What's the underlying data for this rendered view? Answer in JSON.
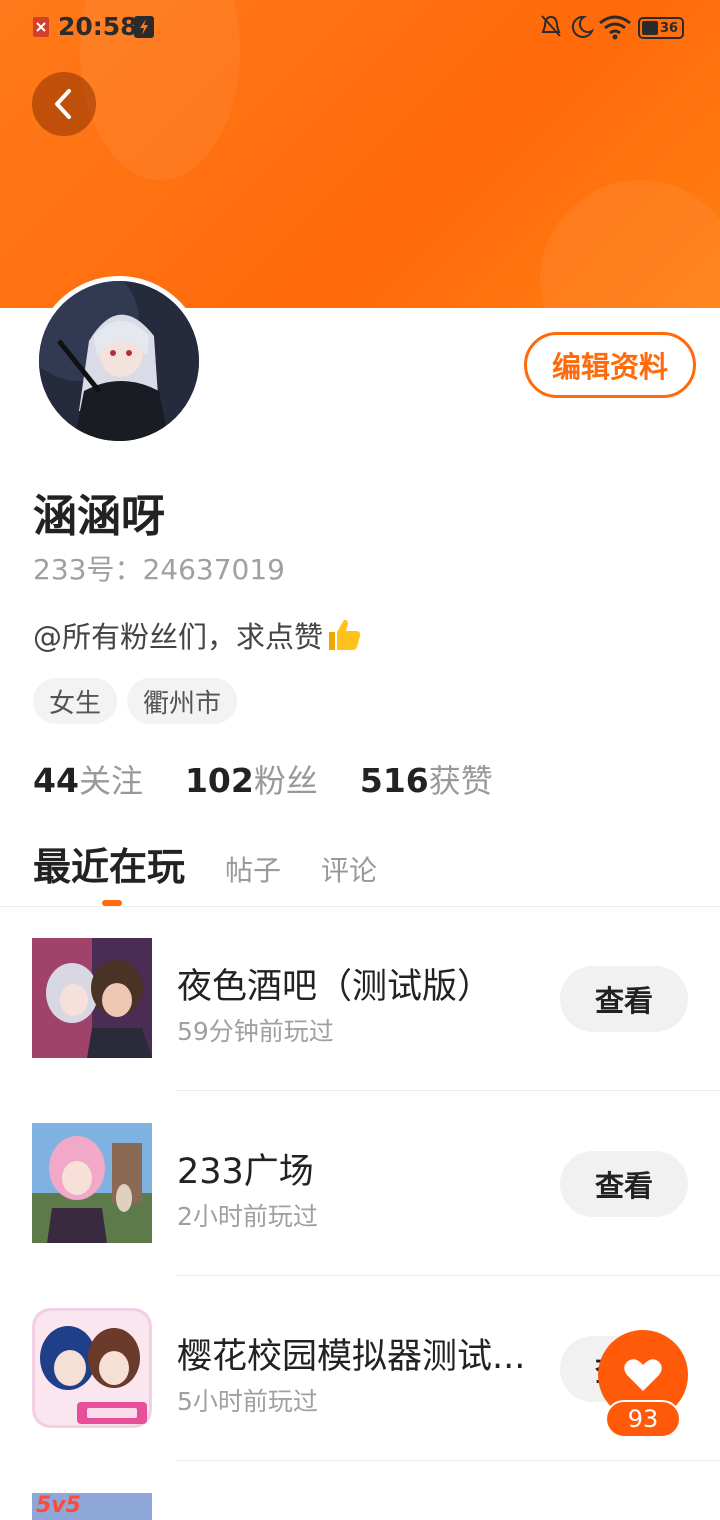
{
  "status_bar": {
    "time": "20:58",
    "battery": "36"
  },
  "profile": {
    "name": "涵涵呀",
    "id_label": "233号：24637019",
    "bio": "@所有粉丝们，求点赞",
    "tags": [
      "女生",
      "衢州市"
    ],
    "edit_button": "编辑资料"
  },
  "stats": [
    {
      "num": "44",
      "label": "关注"
    },
    {
      "num": "102",
      "label": "粉丝"
    },
    {
      "num": "516",
      "label": "获赞"
    }
  ],
  "tabs": {
    "active": "最近在玩",
    "others": [
      "帖子",
      "评论"
    ]
  },
  "games": [
    {
      "title": "夜色酒吧（测试版）",
      "sub": "59分钟前玩过",
      "button": "查看"
    },
    {
      "title": "233广场",
      "sub": "2小时前玩过",
      "button": "查看"
    },
    {
      "title": "樱花校园模拟器测试...",
      "sub": "5小时前玩过",
      "button": "查看"
    }
  ],
  "partial_game": {
    "badge": "5v5"
  },
  "like_fab": {
    "count": "93"
  },
  "colors": {
    "accent": "#ff6a0a",
    "header": "#ff7a1a"
  }
}
